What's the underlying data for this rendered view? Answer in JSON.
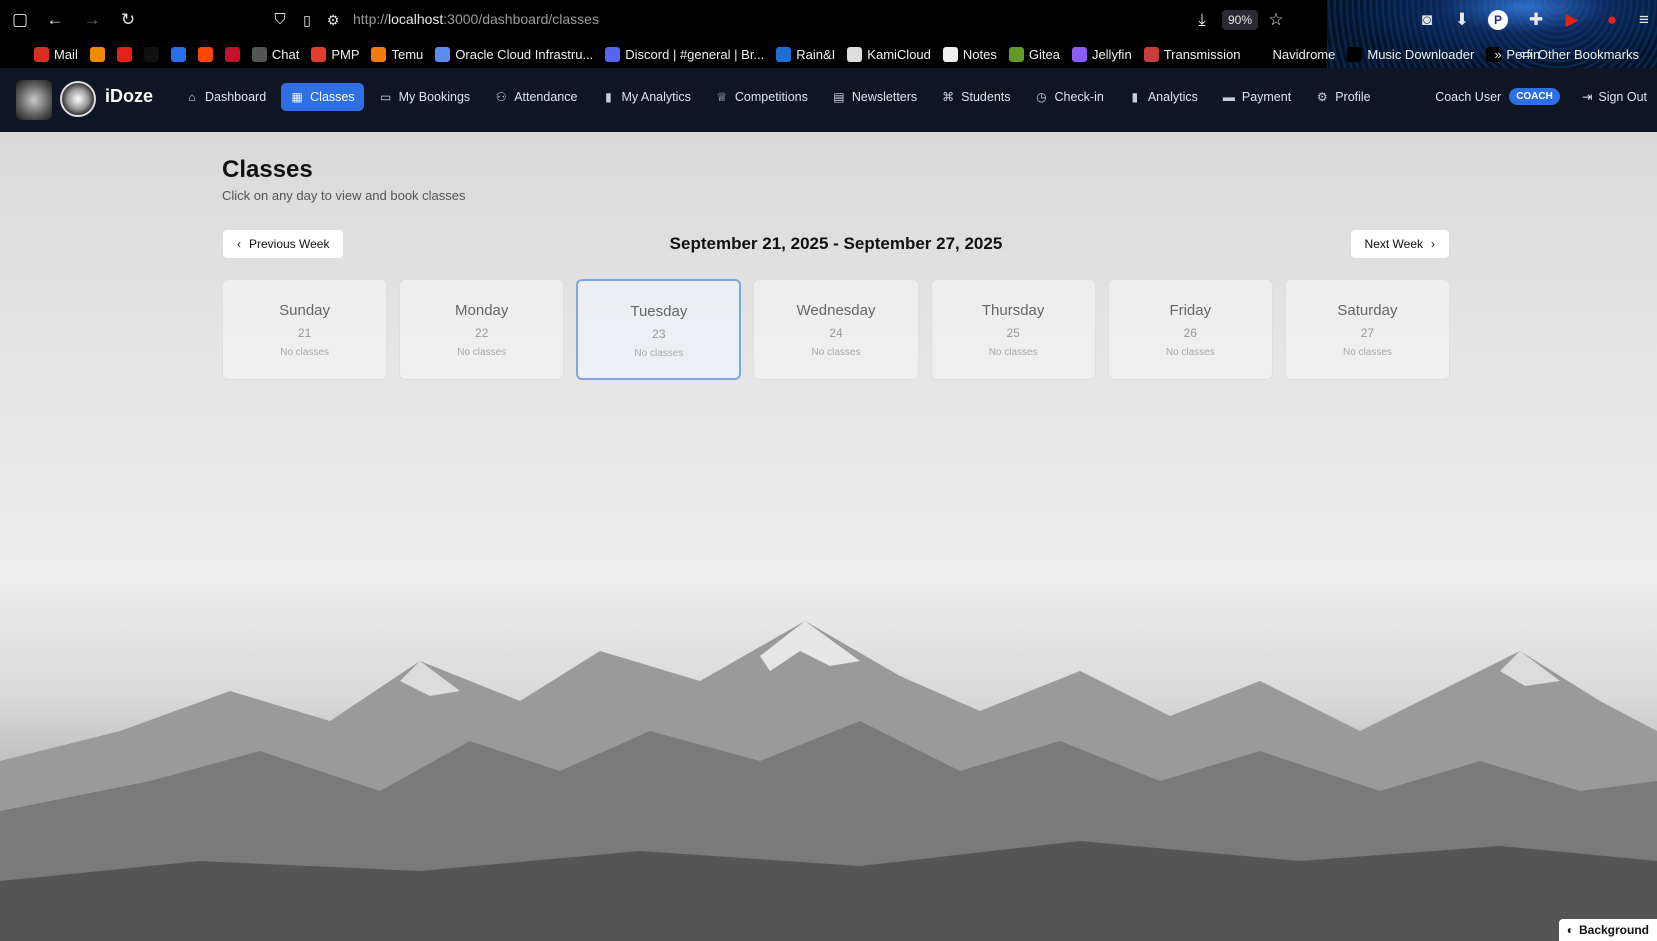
{
  "browser": {
    "url_prefix": "http://",
    "url_host": "localhost",
    "url_path": ":3000/dashboard/classes",
    "zoom": "90%",
    "bookmarks": [
      {
        "label": "Mail",
        "icon": "gmail-icon",
        "color": "#d93025"
      },
      {
        "label": "",
        "icon": "sun-icon",
        "color": "#f08a00"
      },
      {
        "label": "",
        "icon": "youtube-icon",
        "color": "#e62117"
      },
      {
        "label": "",
        "icon": "tv-icon",
        "color": "#111111"
      },
      {
        "label": "",
        "icon": "app-icon",
        "color": "#2a6fe8"
      },
      {
        "label": "",
        "icon": "reddit-icon",
        "color": "#ff4500"
      },
      {
        "label": "",
        "icon": "music-icon",
        "color": "#c0132b"
      },
      {
        "label": "Chat",
        "icon": "chat-icon",
        "color": "#555555"
      },
      {
        "label": "PMP",
        "icon": "pmp-icon",
        "color": "#e23d28"
      },
      {
        "label": "Temu",
        "icon": "temu-icon",
        "color": "#f27b0c"
      },
      {
        "label": "Oracle Cloud Infrastru...",
        "icon": "cloud-icon",
        "color": "#5b8def"
      },
      {
        "label": "Discord | #general | Br...",
        "icon": "discord-icon",
        "color": "#5865f2"
      },
      {
        "label": "Rain&I",
        "icon": "rain-icon",
        "color": "#1c6fd6"
      },
      {
        "label": "KamiCloud",
        "icon": "kamicloud-icon",
        "color": "#dddddd"
      },
      {
        "label": "Notes",
        "icon": "notes-icon",
        "color": "#eeeeee"
      },
      {
        "label": "Gitea",
        "icon": "gitea-icon",
        "color": "#609926"
      },
      {
        "label": "Jellyfin",
        "icon": "jellyfin-icon",
        "color": "#8a5cf5"
      },
      {
        "label": "Transmission",
        "icon": "transmission-icon",
        "color": "#c73c3c"
      },
      {
        "label": "Navidrome",
        "icon": "globe-icon",
        "color": "#000000"
      },
      {
        "label": "Music Downloader",
        "icon": "globe-icon",
        "color": "#000000"
      },
      {
        "label": "Perfin",
        "icon": "globe-icon",
        "color": "#000000"
      }
    ],
    "other_bookmarks": "Other Bookmarks"
  },
  "app": {
    "brand": "iDoze",
    "nav": [
      {
        "label": "Dashboard",
        "icon": "home-icon",
        "active": false
      },
      {
        "label": "Classes",
        "icon": "calendar-icon",
        "active": true
      },
      {
        "label": "My Bookings",
        "icon": "book-icon",
        "active": false
      },
      {
        "label": "Attendance",
        "icon": "user-check-icon",
        "active": false
      },
      {
        "label": "My Analytics",
        "icon": "bar-chart-icon",
        "active": false
      },
      {
        "label": "Competitions",
        "icon": "trophy-icon",
        "active": false
      },
      {
        "label": "Newsletters",
        "icon": "newspaper-icon",
        "active": false
      },
      {
        "label": "Students",
        "icon": "graduation-cap-icon",
        "active": false
      },
      {
        "label": "Check-in",
        "icon": "clock-icon",
        "active": false
      },
      {
        "label": "Analytics",
        "icon": "bar-chart-icon",
        "active": false
      },
      {
        "label": "Payment",
        "icon": "credit-card-icon",
        "active": false
      },
      {
        "label": "Profile",
        "icon": "gear-icon",
        "active": false
      }
    ],
    "user_name": "Coach User",
    "role": "COACH",
    "sign_out": "Sign Out"
  },
  "classes": {
    "title": "Classes",
    "subtitle": "Click on any day to view and book classes",
    "prev_week": "Previous Week",
    "next_week": "Next Week",
    "week_range": "September 21, 2025 - September 27, 2025",
    "days": [
      {
        "name": "Sunday",
        "num": "21",
        "status": "No classes",
        "selected": false
      },
      {
        "name": "Monday",
        "num": "22",
        "status": "No classes",
        "selected": false
      },
      {
        "name": "Tuesday",
        "num": "23",
        "status": "No classes",
        "selected": true
      },
      {
        "name": "Wednesday",
        "num": "24",
        "status": "No classes",
        "selected": false
      },
      {
        "name": "Thursday",
        "num": "25",
        "status": "No classes",
        "selected": false
      },
      {
        "name": "Friday",
        "num": "26",
        "status": "No classes",
        "selected": false
      },
      {
        "name": "Saturday",
        "num": "27",
        "status": "No classes",
        "selected": false
      }
    ]
  },
  "background_button": "Background"
}
